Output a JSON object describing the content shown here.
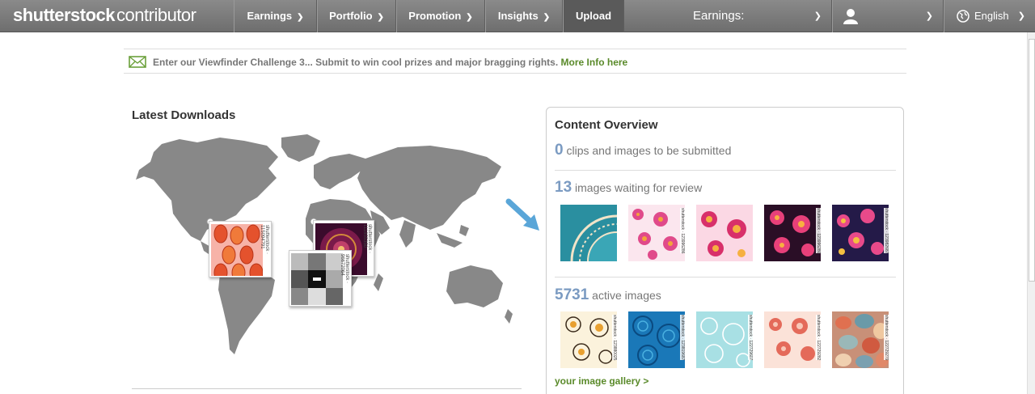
{
  "header": {
    "logo_brand": "shutterstock",
    "logo_sub": "contributor",
    "nav": [
      {
        "label": "Earnings"
      },
      {
        "label": "Portfolio"
      },
      {
        "label": "Promotion"
      },
      {
        "label": "Insights"
      },
      {
        "label": "Upload"
      }
    ],
    "earnings_label": "Earnings:",
    "language": "English"
  },
  "announcement": {
    "text": "Enter our Viewfinder Challenge 3... Submit to win cool prizes and major bragging rights.",
    "link": "More Info here"
  },
  "latest_downloads": {
    "title": "Latest Downloads",
    "items": [
      {
        "id_text": "shutterstock · 115094791"
      },
      {
        "id_text": "shutterstock · 111855350"
      },
      {
        "id_text": "shutterstock · 96672064"
      }
    ]
  },
  "content_overview": {
    "title": "Content Overview",
    "to_submit": {
      "count": "0",
      "label": "clips and images to be submitted"
    },
    "waiting": {
      "count": "13",
      "label": "images waiting for review",
      "thumbs": [
        {
          "id_text": ""
        },
        {
          "id_text": "shutterstock · 123996286"
        },
        {
          "id_text": ""
        },
        {
          "id_text": "shutterstock · 123996280"
        },
        {
          "id_text": "shutterstock · 123982687"
        }
      ]
    },
    "active": {
      "count": "5731",
      "label": "active images",
      "thumbs": [
        {
          "id_text": "shutterstock · 123880025"
        },
        {
          "id_text": "shutterstock · 123819687"
        },
        {
          "id_text": "shutterstock · 122729607"
        },
        {
          "id_text": "shutterstock · 122729282"
        },
        {
          "id_text": "shutterstock · 122729279"
        }
      ]
    },
    "gallery_link": "your image gallery >"
  }
}
